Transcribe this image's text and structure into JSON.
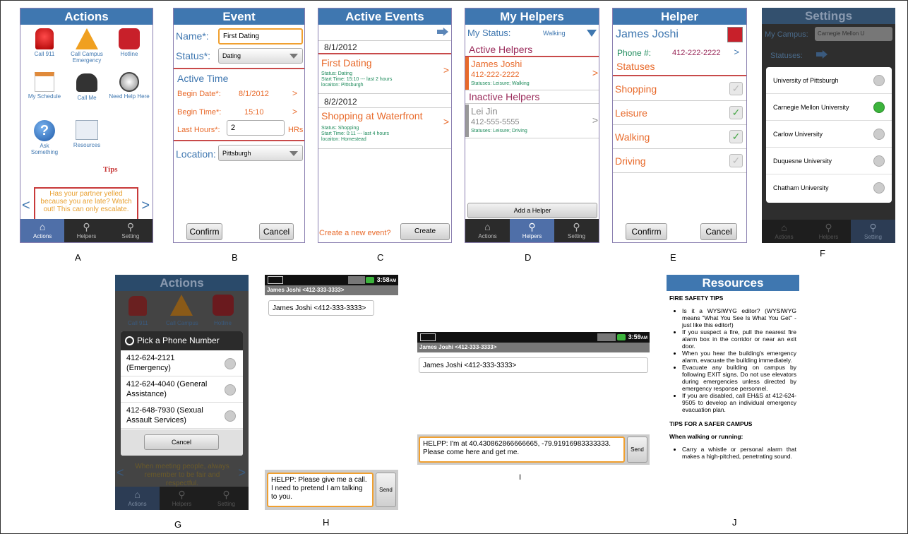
{
  "captions": [
    "A",
    "B",
    "C",
    "D",
    "E",
    "F",
    "G",
    "H",
    "I",
    "J"
  ],
  "tabs": {
    "actions": "Actions",
    "helpers": "Helpers",
    "setting": "Setting"
  },
  "a": {
    "title": "Actions",
    "icons": [
      "Call 911",
      "Call Campus Emergency",
      "Hotline",
      "My Schedule",
      "Call Me",
      "Need Help Here",
      "Ask Something",
      "Resources"
    ],
    "tips_label": "Tips",
    "tip": "Has your partner yelled because you are late? Watch out! This can only escalate."
  },
  "b": {
    "title": "Event",
    "name_label": "Name*:",
    "name_value": "First Dating",
    "status_label": "Status*:",
    "status_value": "Dating",
    "active_time": "Active Time",
    "begin_date_label": "Begin Date*:",
    "begin_date": "8/1/2012",
    "begin_time_label": "Begin Time*:",
    "begin_time": "15:10",
    "last_hours_label": "Last Hours*:",
    "last_hours": "2",
    "hrs": "HRs",
    "location_label": "Location:",
    "location_value": "Pittsburgh",
    "confirm": "Confirm",
    "cancel": "Cancel"
  },
  "c": {
    "title": "Active Events",
    "date1": "8/1/2012",
    "ev1_title": "First Dating",
    "ev1_status": "Status: Dating",
    "ev1_time": "Start Time: 15:10 --- last 2 hours",
    "ev1_loc": "locaiton: Pittsburgh",
    "date2": "8/2/2012",
    "ev2_title": "Shopping at Waterfront",
    "ev2_status": "Status: Shopping",
    "ev2_time": "Start Time: 0:11 --- last 4 hours",
    "ev2_loc": "locaiton: Homestead",
    "create_prompt": "Create a new event?",
    "create": "Create"
  },
  "d": {
    "title": "My Helpers",
    "my_status_label": "My Status:",
    "my_status": "Walking",
    "active_helpers": "Active Helpers",
    "h1_name": "James Joshi",
    "h1_phone": "412-222-2222",
    "h1_statuses": "Statuses: Leisure; Walking",
    "inactive_helpers": "Inactive Helpers",
    "h2_name": "Lei Jin",
    "h2_phone": "412-555-5555",
    "h2_statuses": "Statuses: Leisure; Driving",
    "add_helper": "Add a Helper"
  },
  "e": {
    "title": "Helper",
    "name": "James Joshi",
    "phone_label": "Phone #:",
    "phone": "412-222-2222",
    "statuses": "Statuses",
    "items": [
      "Shopping",
      "Leisure",
      "Walking",
      "Driving"
    ],
    "confirm": "Confirm",
    "cancel": "Cancel"
  },
  "f": {
    "title": "Settings",
    "campus_label": "My Campus:",
    "campus_value": "Carnegie Mellon U",
    "statuses_label": "Statuses:",
    "options": [
      "University of Pittsburgh",
      "Carnegie Mellon University",
      "Carlow University",
      "Duquesne University",
      "Chatham University"
    ]
  },
  "g": {
    "title": "Actions",
    "bg_icons": [
      "Call 911",
      "Call Campus",
      "Hotline"
    ],
    "dialog_title": "Pick a Phone Number",
    "options": [
      "412-624-2121 (Emergency)",
      "412-624-4040 (General Assistance)",
      "412-648-7930 (Sexual Assault Services)"
    ],
    "cancel": "Cancel",
    "bg_tip": "When meeting people, always remember to be fair and respectful."
  },
  "h": {
    "time": "3:58",
    "ampm": "AM",
    "header": "James Joshi <412-333-3333>",
    "recipient": "James Joshi <412-333-3333>",
    "message": "HELPP: Please give me a call. I need to pretend I am talking to you.",
    "send": "Send"
  },
  "i": {
    "time": "3:59",
    "ampm": "AM",
    "header": "James Joshi <412-333-3333>",
    "recipient": "James Joshi <412-333-3333>",
    "message": "HELPP: I'm at 40.430862866666665, -79.91916983333333. Please come here and get me.",
    "send": "Send"
  },
  "j": {
    "title": "Resources",
    "heading1": "FIRE SAFETY TIPS",
    "bullets": [
      "Is it a WYSIWYG editor? (WYSIWYG means \"What You See Is What You Get\" - just like this editor!)",
      "If you suspect a fire, pull the nearest fire alarm box in the corridor or near an exit door.",
      "When you hear the building's emergency alarm, evacuate the building immediately.",
      "Evacuate any building on campus by following EXIT signs. Do not use elevators during emergencies unless directed by emergency response personnel.",
      "If you are disabled, call EH&S at 412-624-9505 to develop an individual emergency evacuation plan."
    ],
    "heading2": "TIPS FOR A SAFER CAMPUS",
    "subheading": "When walking or running:",
    "bullet2": "Carry a whistle or personal alarm that makes a high-pitched, penetrating sound."
  }
}
